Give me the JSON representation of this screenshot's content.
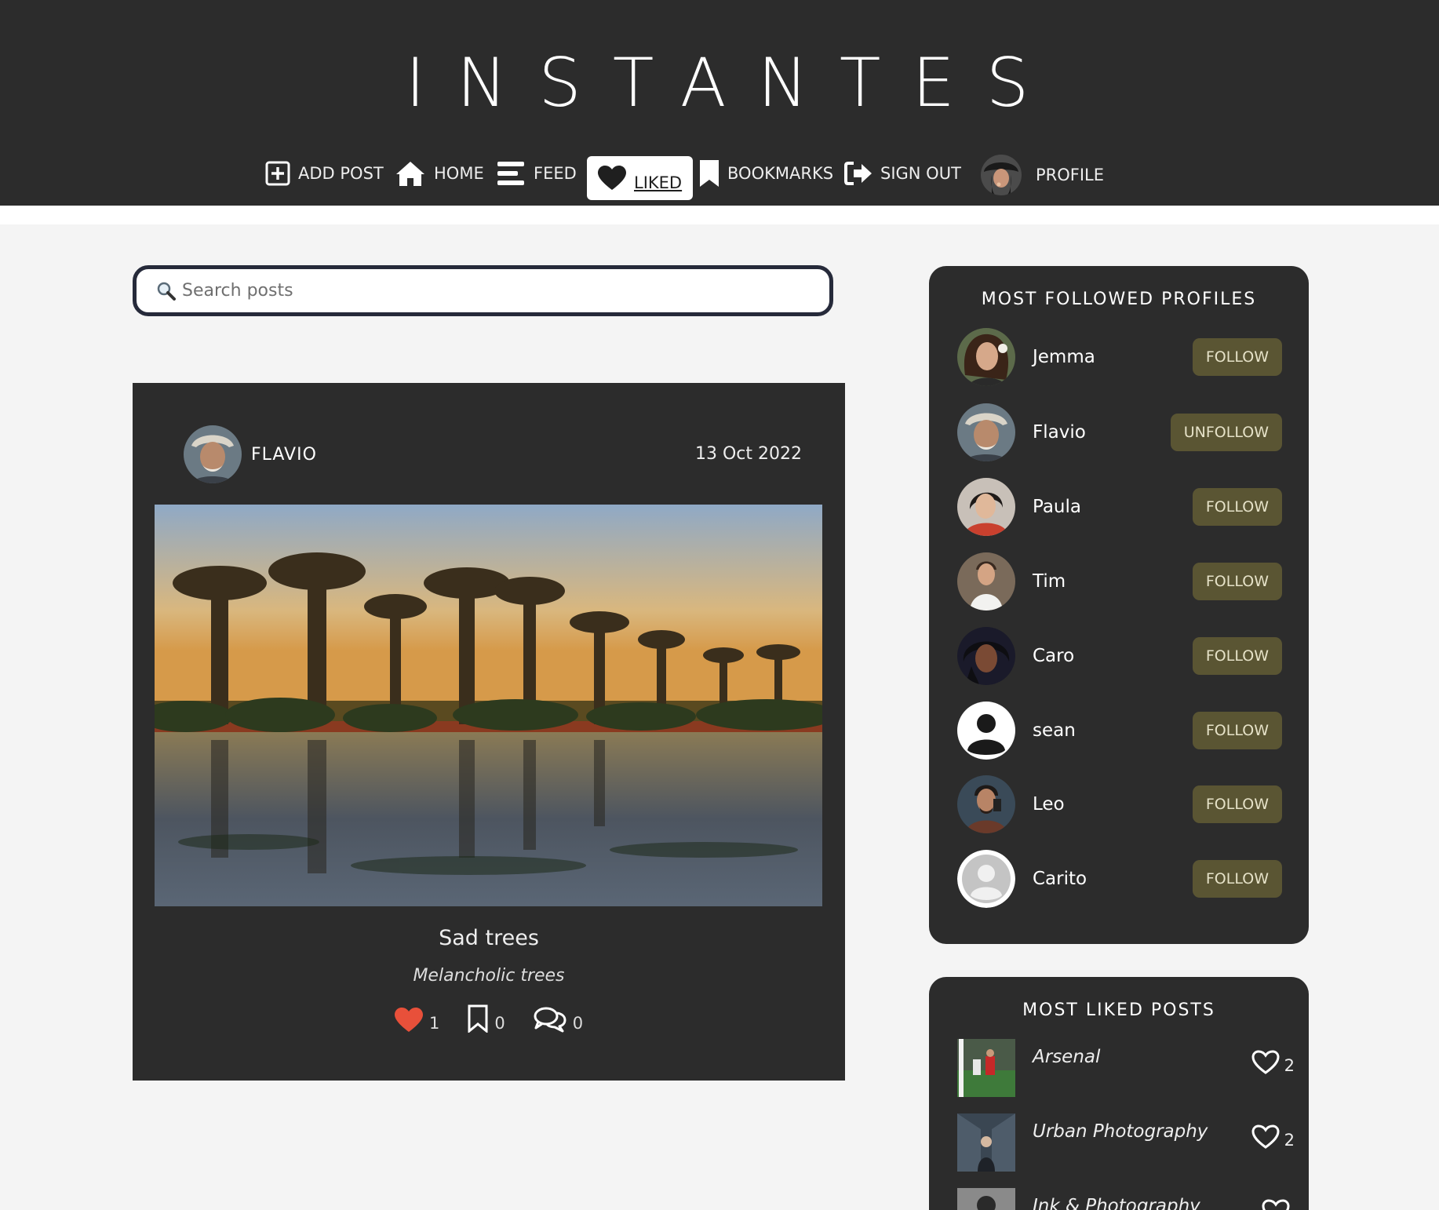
{
  "brand": "INSTANTES",
  "nav": {
    "add_post": "ADD POST",
    "home": "HOME",
    "feed": "FEED",
    "liked": "LIKED",
    "bookmarks": "BOOKMARKS",
    "sign_out": "SIGN OUT",
    "profile": "PROFILE"
  },
  "search": {
    "placeholder": "Search posts"
  },
  "post": {
    "author": "FLAVIO",
    "date": "13 Oct 2022",
    "title": "Sad trees",
    "description": "Melancholic trees",
    "likes": "1",
    "bookmarks": "0",
    "comments": "0"
  },
  "most_followed": {
    "title": "MOST FOLLOWED PROFILES",
    "profiles": [
      {
        "name": "Jemma",
        "button": "FOLLOW"
      },
      {
        "name": "Flavio",
        "button": "UNFOLLOW"
      },
      {
        "name": "Paula",
        "button": "FOLLOW"
      },
      {
        "name": "Tim",
        "button": "FOLLOW"
      },
      {
        "name": "Caro",
        "button": "FOLLOW"
      },
      {
        "name": "sean",
        "button": "FOLLOW"
      },
      {
        "name": "Leo",
        "button": "FOLLOW"
      },
      {
        "name": "Carito",
        "button": "FOLLOW"
      }
    ]
  },
  "most_liked": {
    "title": "MOST LIKED POSTS",
    "posts": [
      {
        "title": "Arsenal",
        "likes": "2"
      },
      {
        "title": "Urban Photography",
        "likes": "2"
      },
      {
        "title": "Ink & Photography",
        "likes": ""
      }
    ]
  },
  "colors": {
    "header_bg": "#2c2c2c",
    "panel_bg": "#2c2c2c",
    "follow_button_bg": "#5a5533",
    "like_active": "#e8503a",
    "search_border": "#262a3a"
  }
}
